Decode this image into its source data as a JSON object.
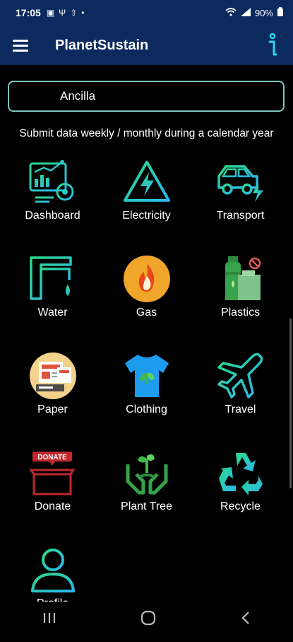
{
  "status_bar": {
    "time": "17:05",
    "battery": "90%"
  },
  "app_bar": {
    "title": "PlanetSustain"
  },
  "search": {
    "value": "Ancilla"
  },
  "subtitle": "Submit data weekly / monthly during a calendar year",
  "tiles": [
    {
      "label": "Dashboard",
      "icon": "dashboard-chart-icon"
    },
    {
      "label": "Electricity",
      "icon": "electricity-warning-icon"
    },
    {
      "label": "Transport",
      "icon": "electric-car-icon"
    },
    {
      "label": "Water",
      "icon": "water-tap-icon"
    },
    {
      "label": "Gas",
      "icon": "gas-flame-icon"
    },
    {
      "label": "Plastics",
      "icon": "plastic-bottle-icon"
    },
    {
      "label": "Paper",
      "icon": "paper-documents-icon"
    },
    {
      "label": "Clothing",
      "icon": "tshirt-leaf-icon"
    },
    {
      "label": "Travel",
      "icon": "airplane-icon"
    },
    {
      "label": "Donate",
      "icon": "donate-box-icon",
      "box_text": "DONATE"
    },
    {
      "label": "Plant Tree",
      "icon": "plant-hands-icon"
    },
    {
      "label": "Recycle",
      "icon": "recycle-icon"
    },
    {
      "label": "Profile",
      "icon": "profile-user-icon"
    }
  ],
  "colors": {
    "bar": "#0d2a5e",
    "accent": "#2bd9c8"
  }
}
